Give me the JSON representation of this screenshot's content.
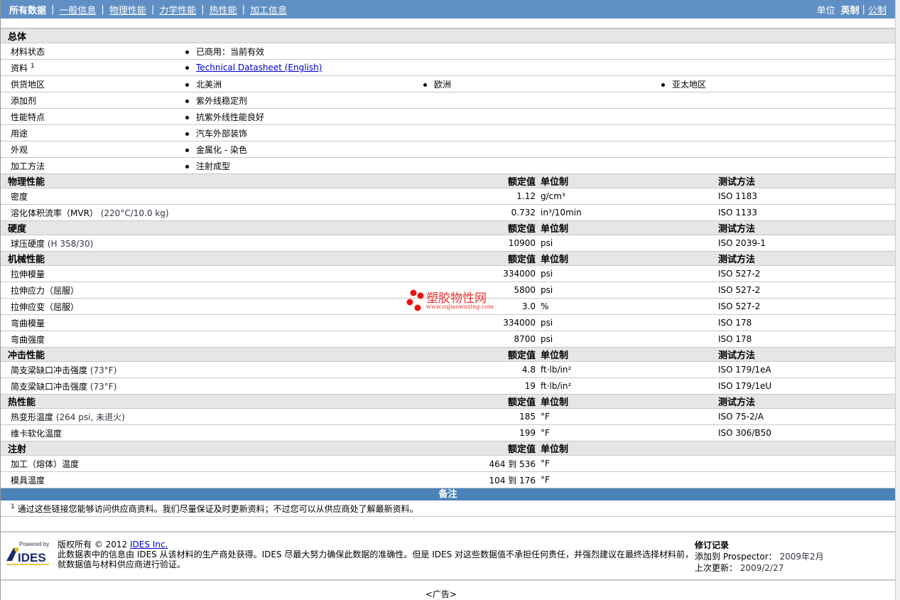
{
  "nav": {
    "items": [
      "所有数据",
      "一般信息",
      "物理性能",
      "力学性能",
      "热性能",
      "加工信息"
    ],
    "unit_label": "单位",
    "unit_current": "英制",
    "unit_other": "公制"
  },
  "general": {
    "title": "总体",
    "rows": [
      {
        "label": "材料状态",
        "values": [
          "已商用：当前有效"
        ]
      },
      {
        "label": "资料",
        "sup": "1",
        "link": "Technical Datasheet (English)"
      },
      {
        "label": "供货地区",
        "values": [
          "北美洲",
          "欧洲",
          "亚太地区"
        ]
      },
      {
        "label": "添加剂",
        "values": [
          "紫外线稳定剂"
        ]
      },
      {
        "label": "性能特点",
        "values": [
          "抗紫外线性能良好"
        ]
      },
      {
        "label": "用途",
        "values": [
          "汽车外部装饰"
        ]
      },
      {
        "label": "外观",
        "values": [
          "金属化 - 染色"
        ]
      },
      {
        "label": "加工方法",
        "values": [
          "注射成型"
        ]
      }
    ]
  },
  "headers": {
    "value": "额定值",
    "unit": "单位制",
    "method": "测试方法"
  },
  "sections": [
    {
      "title": "物理性能",
      "method": true,
      "rows": [
        {
          "label": "密度",
          "note": "",
          "value": "1.12",
          "unit": "g/cm³",
          "method": "ISO 1183"
        },
        {
          "label": "溶化体积流率（MVR）",
          "note": "(220°C/10.0 kg)",
          "value": "0.732",
          "unit": "in³/10min",
          "method": "ISO 1133"
        }
      ]
    },
    {
      "title": "硬度",
      "method": true,
      "rows": [
        {
          "label": "球压硬度",
          "note": "(H 358/30)",
          "value": "10900",
          "unit": "psi",
          "method": "ISO 2039-1"
        }
      ]
    },
    {
      "title": "机械性能",
      "method": true,
      "rows": [
        {
          "label": "拉伸模量",
          "note": "",
          "value": "334000",
          "unit": "psi",
          "method": "ISO 527-2"
        },
        {
          "label": "拉伸应力（屈服）",
          "note": "",
          "value": "5800",
          "unit": "psi",
          "method": "ISO 527-2"
        },
        {
          "label": "拉伸应变（屈服）",
          "note": "",
          "value": "3.0",
          "unit": "%",
          "method": "ISO 527-2"
        },
        {
          "label": "弯曲模量",
          "note": "",
          "value": "334000",
          "unit": "psi",
          "method": "ISO 178"
        },
        {
          "label": "弯曲强度",
          "note": "",
          "value": "8700",
          "unit": "psi",
          "method": "ISO 178"
        }
      ]
    },
    {
      "title": "冲击性能",
      "method": true,
      "rows": [
        {
          "label": "简支梁缺口冲击强度",
          "note": "(73°F)",
          "value": "4.8",
          "unit": "ft·lb/in²",
          "method": "ISO 179/1eA"
        },
        {
          "label": "简支梁缺口冲击强度",
          "note": "(73°F)",
          "value": "19",
          "unit": "ft·lb/in²",
          "method": "ISO 179/1eU"
        }
      ]
    },
    {
      "title": "热性能",
      "method": true,
      "rows": [
        {
          "label": "热变形温度",
          "note": "(264 psi, 未退火)",
          "value": "185",
          "unit": "°F",
          "method": "ISO 75-2/A"
        },
        {
          "label": "维卡软化温度",
          "note": "",
          "value": "199",
          "unit": "°F",
          "method": "ISO 306/B50"
        }
      ]
    },
    {
      "title": "注射",
      "method": false,
      "rows": [
        {
          "label": "加工（熔体）温度",
          "note": "",
          "value": "464 到 536",
          "unit": "°F",
          "method": ""
        },
        {
          "label": "模具温度",
          "note": "",
          "value": "104 到 176",
          "unit": "°F",
          "method": ""
        }
      ]
    }
  ],
  "remarks": {
    "title": "备注",
    "sup": "1",
    "text": "通过这些链接您能够访问供应商资料。我们尽量保证及时更新资料；不过您可以从供应商处了解最新资料。"
  },
  "footer": {
    "logo_top": "Powered by",
    "logo_text": "IDES",
    "copyright": "版权所有 © 2012",
    "company": "IDES Inc.",
    "disclaimer1": "此数据表中的信息由 IDES 从该材料的生产商处获得。IDES 尽最大努力确保此数据的准确性。但是 IDES 对这些数据值不承担任何责任，并强烈建议在最终选择材料前，",
    "disclaimer2": "就数据值与材料供应商进行验证。",
    "rev_title": "修订记录",
    "added_label": "添加到 Prospector：",
    "added_value": "2009年2月",
    "updated_label": "上次更新：",
    "updated_value": "2009/2/27",
    "ad": "<广告>"
  },
  "watermark": {
    "name": "塑胶物性网",
    "url": "www.sujiaowuxing.com",
    "color": "#ee1111"
  },
  "colors": {
    "nav": "#5f8fc4",
    "remarks": "#4a82b8",
    "section": "#e6e6e6"
  }
}
